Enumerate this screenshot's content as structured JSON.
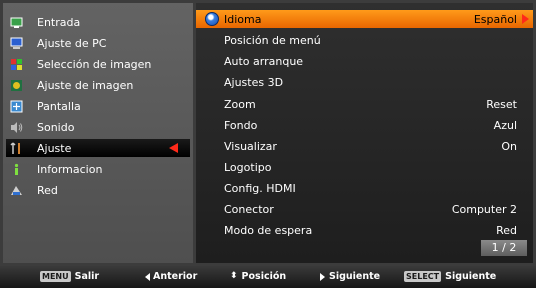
{
  "left_menu": {
    "items": [
      {
        "label": "Entrada",
        "icon": "input-icon"
      },
      {
        "label": "Ajuste de PC",
        "icon": "pc-icon"
      },
      {
        "label": "Selección de imagen",
        "icon": "image-select-icon"
      },
      {
        "label": "Ajuste de imagen",
        "icon": "image-adjust-icon"
      },
      {
        "label": "Pantalla",
        "icon": "screen-icon"
      },
      {
        "label": "Sonido",
        "icon": "speaker-icon"
      },
      {
        "label": "Ajuste",
        "icon": "settings-icon",
        "selected": true
      },
      {
        "label": "Informacion",
        "icon": "info-icon"
      },
      {
        "label": "Red",
        "icon": "network-icon"
      }
    ]
  },
  "right_menu": {
    "items": [
      {
        "label": "Idioma",
        "value": "Español",
        "selected": true
      },
      {
        "label": "Posición de menú",
        "value": ""
      },
      {
        "label": "Auto arranque",
        "value": ""
      },
      {
        "label": "Ajustes 3D",
        "value": ""
      },
      {
        "label": "Zoom",
        "value": "Reset"
      },
      {
        "label": "Fondo",
        "value": "Azul"
      },
      {
        "label": "Visualizar",
        "value": "On"
      },
      {
        "label": "Logotipo",
        "value": ""
      },
      {
        "label": "Config. HDMI",
        "value": ""
      },
      {
        "label": "Conector",
        "value": "Computer 2"
      },
      {
        "label": "Modo de espera",
        "value": "Red"
      }
    ],
    "page": "1 / 2"
  },
  "bottom_bar": {
    "exit_key": "MENU",
    "exit_label": "Salir",
    "prev_label": "Anterior",
    "pos_label": "Posición",
    "next_label": "Siguiente",
    "select_key": "SELECT",
    "select_label": "Siguiente"
  },
  "colors": {
    "highlight": "#f08010",
    "arrow": "#ff2a1a"
  }
}
